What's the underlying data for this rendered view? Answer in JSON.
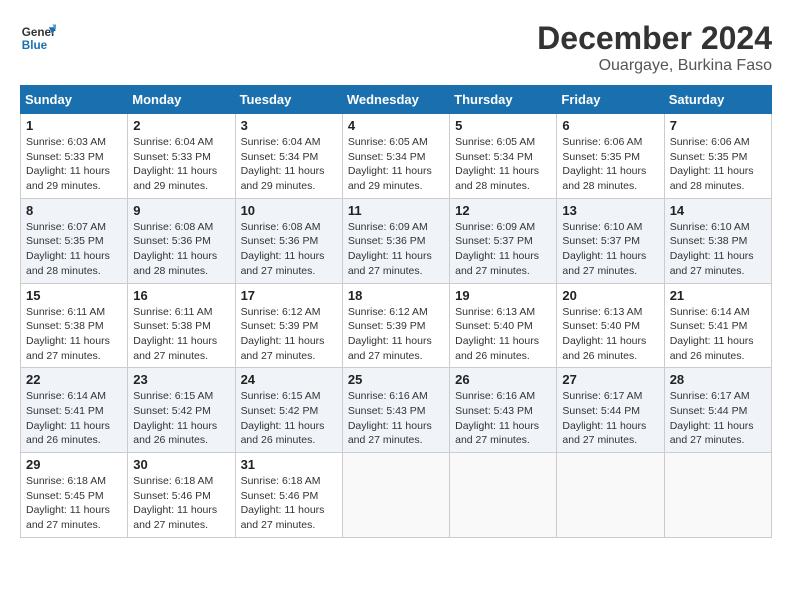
{
  "header": {
    "logo_line1": "General",
    "logo_line2": "Blue",
    "month_year": "December 2024",
    "location": "Ouargaye, Burkina Faso"
  },
  "weekdays": [
    "Sunday",
    "Monday",
    "Tuesday",
    "Wednesday",
    "Thursday",
    "Friday",
    "Saturday"
  ],
  "weeks": [
    [
      {
        "day": "1",
        "info": "Sunrise: 6:03 AM\nSunset: 5:33 PM\nDaylight: 11 hours\nand 29 minutes."
      },
      {
        "day": "2",
        "info": "Sunrise: 6:04 AM\nSunset: 5:33 PM\nDaylight: 11 hours\nand 29 minutes."
      },
      {
        "day": "3",
        "info": "Sunrise: 6:04 AM\nSunset: 5:34 PM\nDaylight: 11 hours\nand 29 minutes."
      },
      {
        "day": "4",
        "info": "Sunrise: 6:05 AM\nSunset: 5:34 PM\nDaylight: 11 hours\nand 29 minutes."
      },
      {
        "day": "5",
        "info": "Sunrise: 6:05 AM\nSunset: 5:34 PM\nDaylight: 11 hours\nand 28 minutes."
      },
      {
        "day": "6",
        "info": "Sunrise: 6:06 AM\nSunset: 5:35 PM\nDaylight: 11 hours\nand 28 minutes."
      },
      {
        "day": "7",
        "info": "Sunrise: 6:06 AM\nSunset: 5:35 PM\nDaylight: 11 hours\nand 28 minutes."
      }
    ],
    [
      {
        "day": "8",
        "info": "Sunrise: 6:07 AM\nSunset: 5:35 PM\nDaylight: 11 hours\nand 28 minutes."
      },
      {
        "day": "9",
        "info": "Sunrise: 6:08 AM\nSunset: 5:36 PM\nDaylight: 11 hours\nand 28 minutes."
      },
      {
        "day": "10",
        "info": "Sunrise: 6:08 AM\nSunset: 5:36 PM\nDaylight: 11 hours\nand 27 minutes."
      },
      {
        "day": "11",
        "info": "Sunrise: 6:09 AM\nSunset: 5:36 PM\nDaylight: 11 hours\nand 27 minutes."
      },
      {
        "day": "12",
        "info": "Sunrise: 6:09 AM\nSunset: 5:37 PM\nDaylight: 11 hours\nand 27 minutes."
      },
      {
        "day": "13",
        "info": "Sunrise: 6:10 AM\nSunset: 5:37 PM\nDaylight: 11 hours\nand 27 minutes."
      },
      {
        "day": "14",
        "info": "Sunrise: 6:10 AM\nSunset: 5:38 PM\nDaylight: 11 hours\nand 27 minutes."
      }
    ],
    [
      {
        "day": "15",
        "info": "Sunrise: 6:11 AM\nSunset: 5:38 PM\nDaylight: 11 hours\nand 27 minutes."
      },
      {
        "day": "16",
        "info": "Sunrise: 6:11 AM\nSunset: 5:38 PM\nDaylight: 11 hours\nand 27 minutes."
      },
      {
        "day": "17",
        "info": "Sunrise: 6:12 AM\nSunset: 5:39 PM\nDaylight: 11 hours\nand 27 minutes."
      },
      {
        "day": "18",
        "info": "Sunrise: 6:12 AM\nSunset: 5:39 PM\nDaylight: 11 hours\nand 27 minutes."
      },
      {
        "day": "19",
        "info": "Sunrise: 6:13 AM\nSunset: 5:40 PM\nDaylight: 11 hours\nand 26 minutes."
      },
      {
        "day": "20",
        "info": "Sunrise: 6:13 AM\nSunset: 5:40 PM\nDaylight: 11 hours\nand 26 minutes."
      },
      {
        "day": "21",
        "info": "Sunrise: 6:14 AM\nSunset: 5:41 PM\nDaylight: 11 hours\nand 26 minutes."
      }
    ],
    [
      {
        "day": "22",
        "info": "Sunrise: 6:14 AM\nSunset: 5:41 PM\nDaylight: 11 hours\nand 26 minutes."
      },
      {
        "day": "23",
        "info": "Sunrise: 6:15 AM\nSunset: 5:42 PM\nDaylight: 11 hours\nand 26 minutes."
      },
      {
        "day": "24",
        "info": "Sunrise: 6:15 AM\nSunset: 5:42 PM\nDaylight: 11 hours\nand 26 minutes."
      },
      {
        "day": "25",
        "info": "Sunrise: 6:16 AM\nSunset: 5:43 PM\nDaylight: 11 hours\nand 27 minutes."
      },
      {
        "day": "26",
        "info": "Sunrise: 6:16 AM\nSunset: 5:43 PM\nDaylight: 11 hours\nand 27 minutes."
      },
      {
        "day": "27",
        "info": "Sunrise: 6:17 AM\nSunset: 5:44 PM\nDaylight: 11 hours\nand 27 minutes."
      },
      {
        "day": "28",
        "info": "Sunrise: 6:17 AM\nSunset: 5:44 PM\nDaylight: 11 hours\nand 27 minutes."
      }
    ],
    [
      {
        "day": "29",
        "info": "Sunrise: 6:18 AM\nSunset: 5:45 PM\nDaylight: 11 hours\nand 27 minutes."
      },
      {
        "day": "30",
        "info": "Sunrise: 6:18 AM\nSunset: 5:46 PM\nDaylight: 11 hours\nand 27 minutes."
      },
      {
        "day": "31",
        "info": "Sunrise: 6:18 AM\nSunset: 5:46 PM\nDaylight: 11 hours\nand 27 minutes."
      },
      {
        "day": "",
        "info": ""
      },
      {
        "day": "",
        "info": ""
      },
      {
        "day": "",
        "info": ""
      },
      {
        "day": "",
        "info": ""
      }
    ]
  ]
}
